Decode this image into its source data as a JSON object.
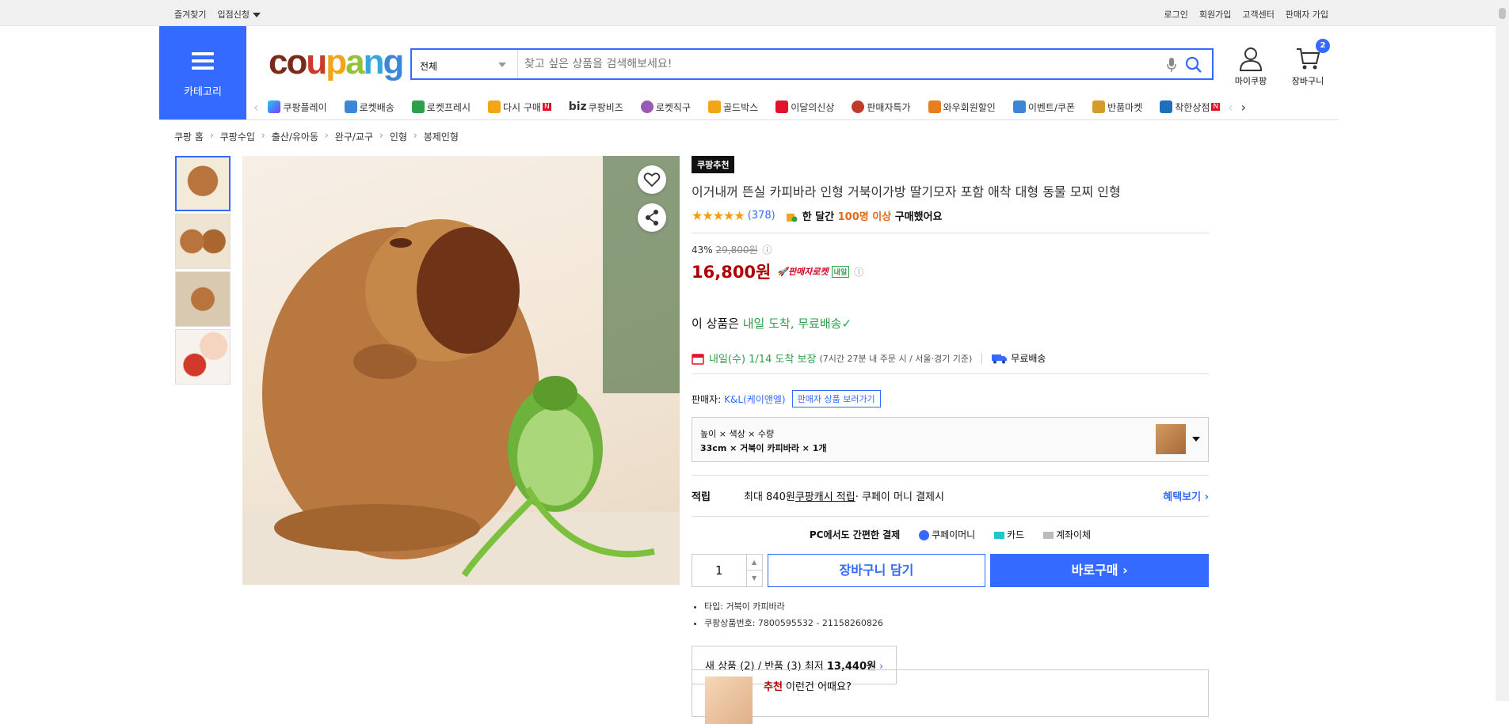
{
  "topbar": {
    "left": [
      "즐겨찾기",
      "입점신청"
    ],
    "right": [
      "로그인",
      "회원가입",
      "고객센터",
      "판매자 가입"
    ]
  },
  "header": {
    "category_label": "카테고리",
    "logo": "coupang",
    "search_category": "전체",
    "search_placeholder": "찾고 싶은 상품을 검색해보세요!",
    "mypage_label": "마이쿠팡",
    "cart_label": "장바구니",
    "cart_count": "2"
  },
  "nav": [
    "쿠팡플레이",
    "로켓배송",
    "로켓프레시",
    "다시 구매",
    "쿠팡비즈",
    "로켓직구",
    "골드박스",
    "이달의신상",
    "판매자특가",
    "와우회원할인",
    "이벤트/쿠폰",
    "반품마켓",
    "착한상점"
  ],
  "breadcrumb": [
    "쿠팡 홈",
    "쿠팡수입",
    "출산/유아동",
    "완구/교구",
    "인형",
    "봉제인형"
  ],
  "product": {
    "badge": "쿠팡추천",
    "title": "이거내꺼 뜬실 카피바라 인형 거북이가방 딸기모자 포함 애착 대형 동물 모찌 인형",
    "stars": "★★★★★",
    "review_count": "(378)",
    "bought_prefix": "한 달간 ",
    "bought_strong": "100명 이상",
    "bought_suffix": " 구매했어요",
    "discount": "43%",
    "orig_price": "29,800원",
    "price": "16,800원",
    "rocket": "판매자로켓",
    "tomorrow_tag": "내일",
    "delivery_main_prefix": "이 상품은 ",
    "delivery_main_green": "내일 도착, 무료배송",
    "delivery_detail_green": "내일(수) 1/14 도착 보장",
    "delivery_detail_small": "(7시간 27분 내 주문 시 / 서울·경기 기준)",
    "free_ship": "무료배송",
    "seller_label": "판매자:",
    "seller_name": "K&L(케이앤엘)",
    "seller_btn": "판매자 상품 보러가기",
    "option_label": "높이 × 색상 × 수량",
    "option_value": "33cm × 거북이 카피바라 × 1개",
    "reward_key": "적립",
    "reward_text_1": "최대 840원 ",
    "reward_link": "쿠팡캐시 적립",
    "reward_text_2": " · 쿠페이 머니 결제시",
    "reward_benefit": "혜택보기 ›",
    "pcpay_label": "PC에서도 간편한 결제",
    "pay_methods": [
      "쿠페이머니",
      "카드",
      "계좌이체"
    ],
    "quantity": "1",
    "add_cart": "장바구니 담기",
    "buy_now": "바로구매 ›",
    "specs": [
      "타입: 거북이 카피바라",
      "쿠팡상품번호: 7800595532 - 21158260826"
    ],
    "new_returns_prefix": "새 상품 (2) / 반품 (3) 최저 ",
    "new_returns_price": "13,440원",
    "rec_red": "추천",
    "rec_text": " 이런건 어때요?"
  },
  "colors": {
    "accent": "#346aff",
    "price": "#ae0000",
    "green": "#2e9f4b"
  }
}
